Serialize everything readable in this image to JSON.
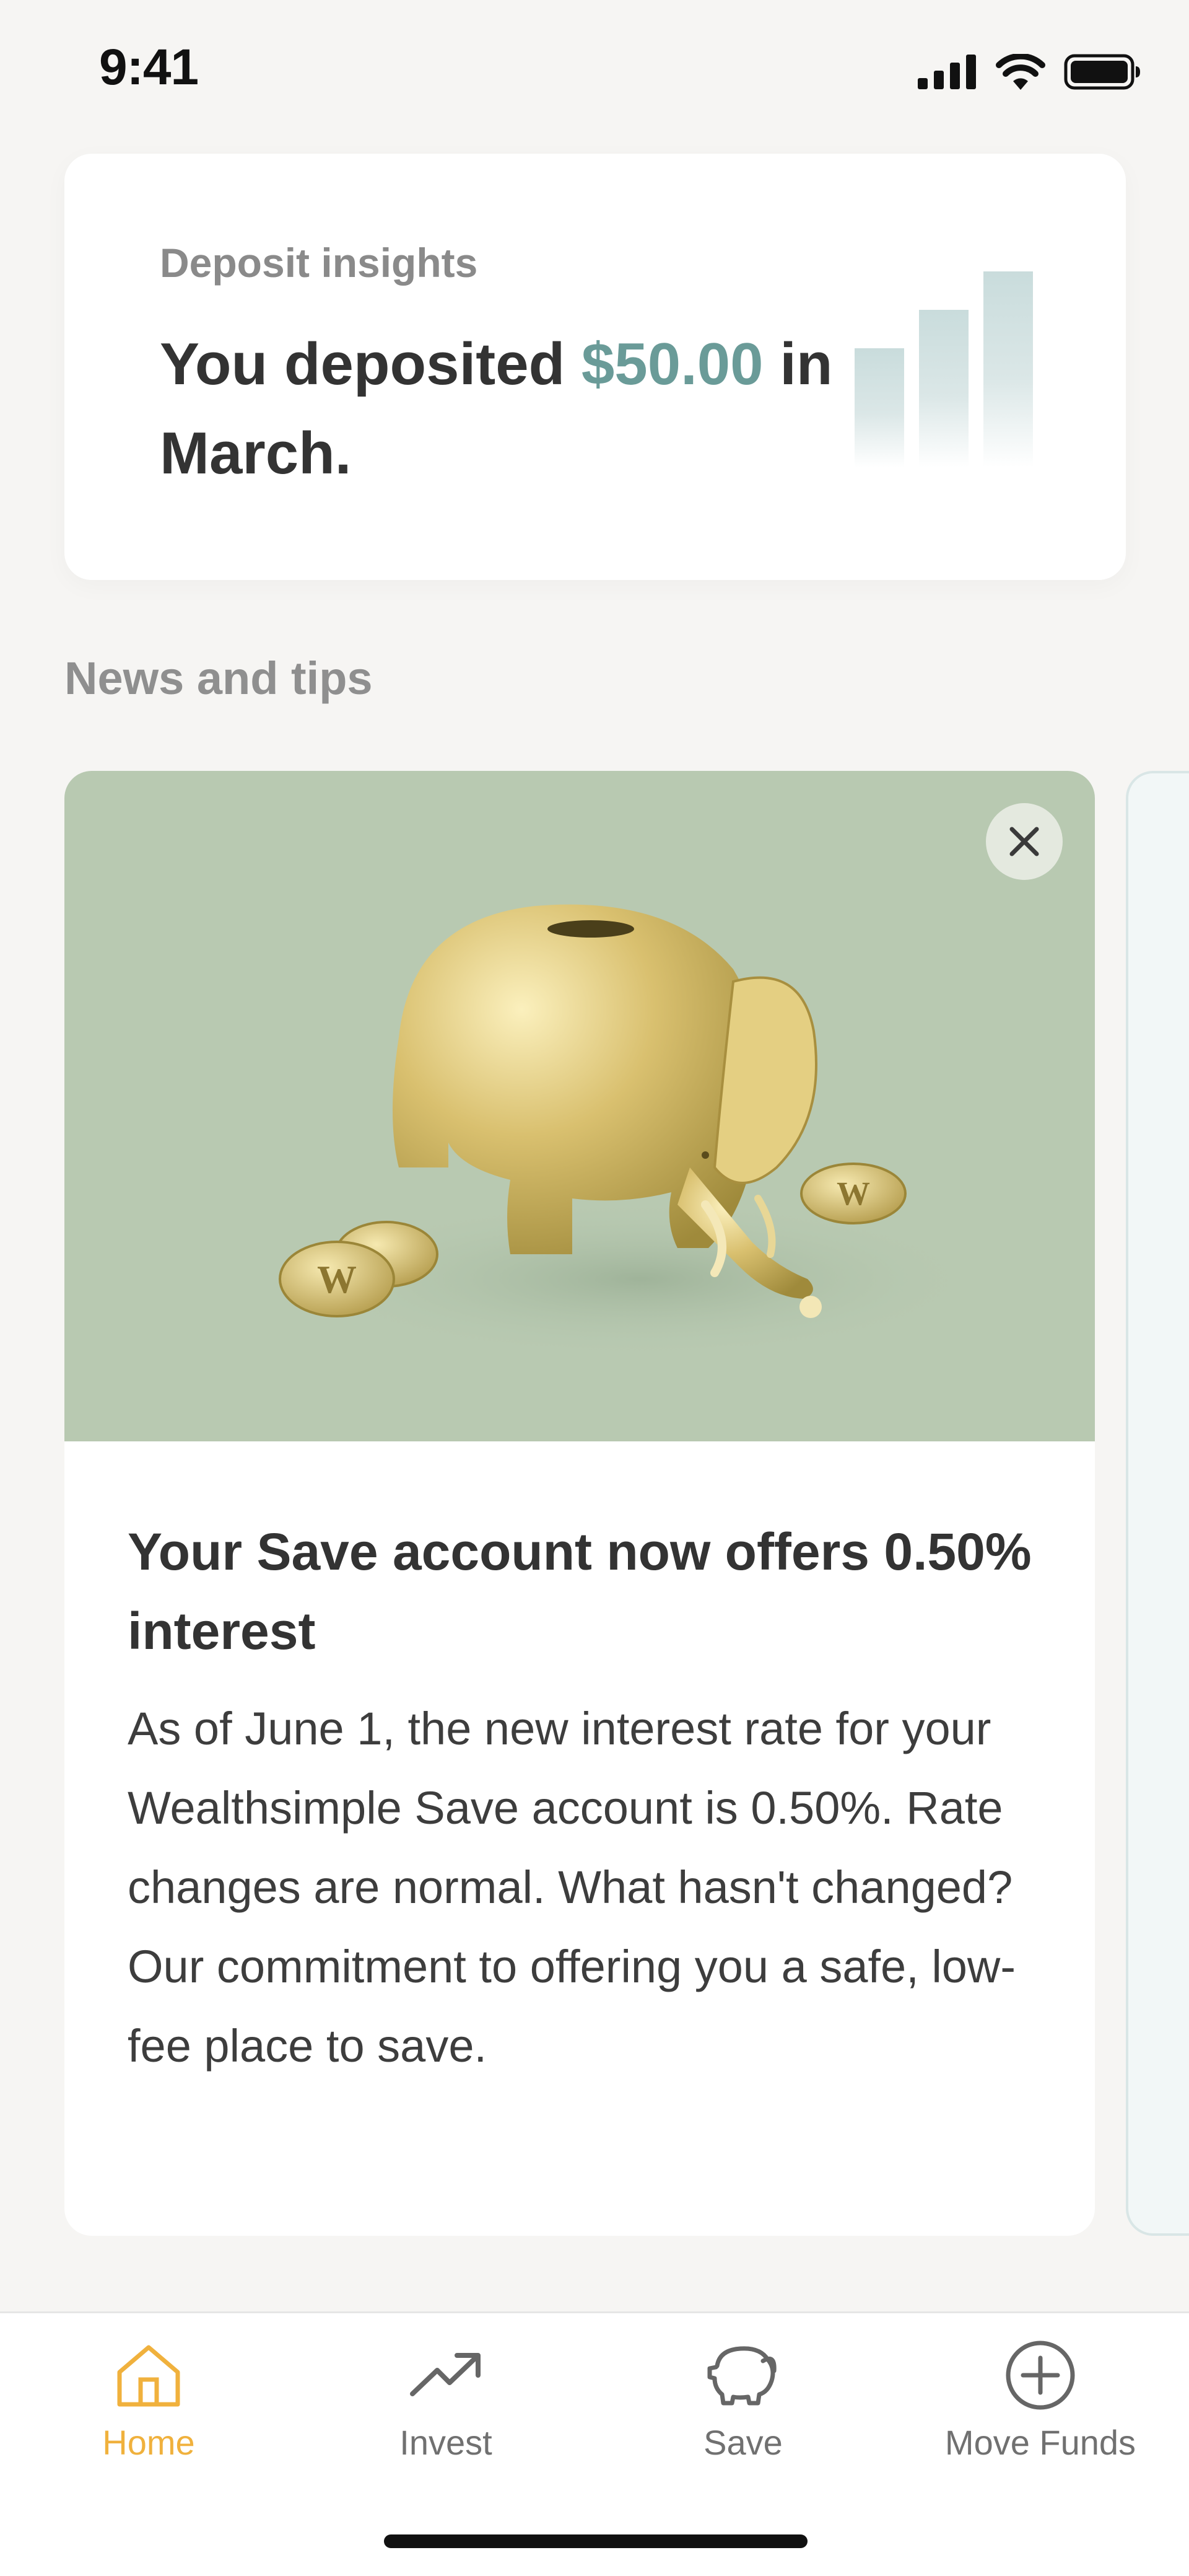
{
  "status_bar": {
    "time": "9:41",
    "icons": [
      "cellular-signal-icon",
      "wifi-icon",
      "battery-icon"
    ]
  },
  "deposit_insights": {
    "label": "Deposit insights",
    "text_before": "You deposited ",
    "amount": "$50.00",
    "text_after": " in March.",
    "amount_color": "#6a9b98"
  },
  "news": {
    "section_title": "News and tips",
    "cards": [
      {
        "image": "gold-elephant-piggy-bank-with-coins",
        "title": "Your Save account now offers 0.50% interest",
        "body": "As of June 1, the new interest rate for your Wealthsimple Save account is 0.50%. Rate changes are normal. What hasn't changed? Our commitment to offering you a safe, low-fee place to save.",
        "image_bg": "#b8c9b1"
      }
    ]
  },
  "tab_bar": {
    "active_color": "#f0b13d",
    "tabs": [
      {
        "label": "Home",
        "icon": "home-icon",
        "active": true
      },
      {
        "label": "Invest",
        "icon": "trend-up-icon",
        "active": false
      },
      {
        "label": "Save",
        "icon": "piggy-bank-icon",
        "active": false
      },
      {
        "label": "Move Funds",
        "icon": "plus-circle-icon",
        "active": false
      }
    ]
  }
}
